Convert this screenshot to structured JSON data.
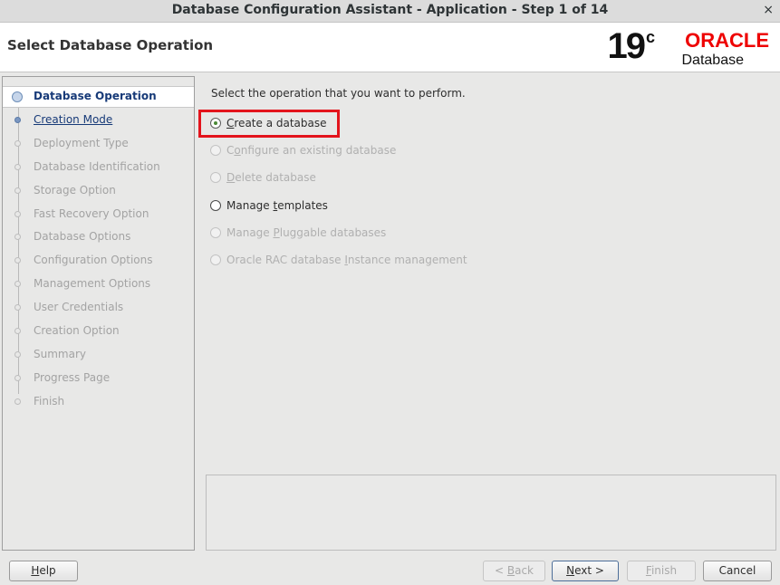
{
  "window": {
    "title": "Database Configuration Assistant - Application - Step 1 of 14",
    "close_glyph": "×"
  },
  "header": {
    "page_title": "Select Database Operation",
    "logo": {
      "version": "19",
      "version_sup": "c",
      "brand": "ORACLE",
      "product": "Database",
      "brand_color": "#e00000"
    }
  },
  "steps": [
    {
      "label": "Database Operation",
      "state": "active"
    },
    {
      "label": "Creation Mode",
      "state": "next"
    },
    {
      "label": "Deployment Type",
      "state": "pending"
    },
    {
      "label": "Database Identification",
      "state": "pending"
    },
    {
      "label": "Storage Option",
      "state": "pending"
    },
    {
      "label": "Fast Recovery Option",
      "state": "pending"
    },
    {
      "label": "Database Options",
      "state": "pending"
    },
    {
      "label": "Configuration Options",
      "state": "pending"
    },
    {
      "label": "Management Options",
      "state": "pending"
    },
    {
      "label": "User Credentials",
      "state": "pending"
    },
    {
      "label": "Creation Option",
      "state": "pending"
    },
    {
      "label": "Summary",
      "state": "pending"
    },
    {
      "label": "Progress Page",
      "state": "pending"
    },
    {
      "label": "Finish",
      "state": "pending"
    }
  ],
  "content": {
    "prompt": "Select the operation that you want to perform.",
    "options": [
      {
        "label": "Create a database",
        "mnemonic": "C",
        "selected": true,
        "enabled": true
      },
      {
        "label": "Configure an existing database",
        "mnemonic": "o",
        "selected": false,
        "enabled": false
      },
      {
        "label": "Delete database",
        "mnemonic": "D",
        "selected": false,
        "enabled": false
      },
      {
        "label": "Manage templates",
        "mnemonic": "t",
        "selected": false,
        "enabled": true
      },
      {
        "label": "Manage Pluggable databases",
        "mnemonic": "P",
        "selected": false,
        "enabled": false
      },
      {
        "label": "Oracle RAC database Instance management",
        "mnemonic": "I",
        "selected": false,
        "enabled": false
      }
    ]
  },
  "buttons": {
    "help": {
      "label": "Help",
      "mnemonic": "H"
    },
    "back": {
      "label": "< Back",
      "mnemonic": "B"
    },
    "next": {
      "label": "Next >",
      "mnemonic": "N"
    },
    "finish": {
      "label": "Finish",
      "mnemonic": "F"
    },
    "cancel": {
      "label": "Cancel"
    }
  },
  "colors": {
    "highlight": "#e3141c",
    "active_step": "#173a78",
    "radio_selected": "#4b8a36"
  }
}
